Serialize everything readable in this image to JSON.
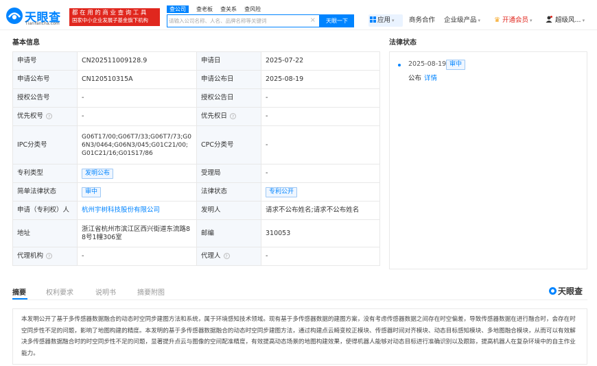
{
  "header": {
    "logo_cn": "天眼查",
    "logo_en": "TianYancha.com",
    "slogan_line1": "都在用的商业查询工具",
    "slogan_line2": "国家中小企业发展子基金旗下机构",
    "search_tabs": [
      {
        "label": "查公司",
        "active": true
      },
      {
        "label": "查老板",
        "active": false
      },
      {
        "label": "查关系",
        "active": false
      },
      {
        "label": "查风险",
        "active": false
      }
    ],
    "search_placeholder": "请输入公司名称、人名、品牌名称等关键词",
    "search_button": "天眼一下",
    "nav": {
      "apps": "应用",
      "business": "商务合作",
      "enterprise": "企业级产品",
      "vip": "开通会员",
      "user": "超级风..."
    }
  },
  "basic_info": {
    "title": "基本信息",
    "rows": [
      {
        "label1": "申请号",
        "value1": "CN202511009128.9",
        "label2": "申请日",
        "value2": "2025-07-22"
      },
      {
        "label1": "申请公布号",
        "value1": "CN120510315A",
        "label2": "申请公布日",
        "value2": "2025-08-19"
      },
      {
        "label1": "授权公告号",
        "value1": "-",
        "label2": "授权公告日",
        "value2": "-"
      },
      {
        "label1": "优先权号",
        "value1": "-",
        "label2": "优先权日",
        "value2": "-"
      },
      {
        "label1": "IPC分类号",
        "value1": "G06T17/00;G06T7/33;G06T7/73;G06N3/0464;G06N3/045;G01C21/00;G01C21/16;G01S17/86",
        "label2": "CPC分类号",
        "value2": "-"
      },
      {
        "label1": "专利类型",
        "value1": "发明公布",
        "label2": "受理局",
        "value2": "-"
      },
      {
        "label1": "简单法律状态",
        "value1": "审中",
        "label2": "法律状态",
        "value2": "专利公开"
      },
      {
        "label1": "申请（专利权）人",
        "value1": "杭州宇树科技股份有限公司",
        "label2": "发明人",
        "value2": "请求不公布姓名;请求不公布姓名"
      },
      {
        "label1": "地址",
        "value1": "浙江省杭州市滨江区西兴街道东流路88号1幢306室",
        "label2": "邮编",
        "value2": "310053"
      },
      {
        "label1": "代理机构",
        "value1": "-",
        "label2": "代理人",
        "value2": "-"
      }
    ]
  },
  "legal_status": {
    "title": "法律状态",
    "date": "2025-08-19",
    "tag": "审中",
    "text": "公布",
    "detail": "详情"
  },
  "tabs": [
    {
      "label": "摘要",
      "active": true
    },
    {
      "label": "权利要求",
      "active": false
    },
    {
      "label": "说明书",
      "active": false
    },
    {
      "label": "摘要附图",
      "active": false
    }
  ],
  "brand": "天眼查",
  "abstract": "本发明公开了基于多传感器数据融合的动态时空同步建图方法和系统，属于环境感知技术领域。现有基于多传感器数据的建图方案，没有考虑传感器数据之间存在时空偏差，导致传感器数据在进行融合时，会存在时空同步性不足的问题，影响了地图构建的精度。本发明的基于多传感器数据融合的动态时空同步建图方法，通过构建点云畸变校正模块、传感器时间对齐模块、动态目标感知模块、多地图融合模块，从而可以有效解决多传感器数据融合时的时空同步性不足的问题，显著提升点云与图像的空间配准精度，有效提高动态场景的地图构建效果，使得机器人能够对动态目标进行准确识别以及跟踪，提高机器人在复杂环境中的自主作业能力。",
  "colors": {
    "accent": "#0084ff",
    "slogan_bg": "#e0271e",
    "label_bg": "#f5f8fc"
  }
}
